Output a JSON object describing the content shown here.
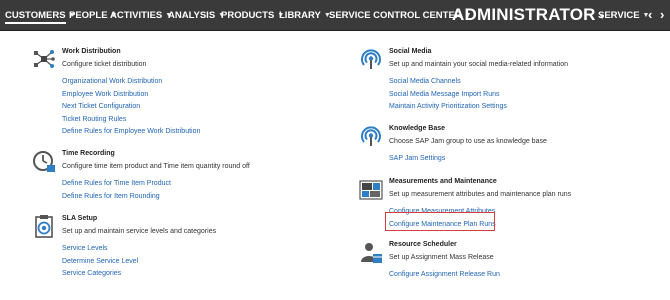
{
  "nav": {
    "customers": "CUSTOMERS",
    "people": "PEOPLE",
    "activities": "ACTIVITIES",
    "analysis": "ANALYSIS",
    "products": "PRODUCTS",
    "library": "LIBRARY",
    "service_control_center": "SERVICE CONTROL CENTER",
    "administrator": "ADMINISTRATOR",
    "service": "SERVICE"
  },
  "sections": {
    "work_distribution": {
      "title": "Work Distribution",
      "description": "Configure ticket distribution",
      "links": [
        "Organizational Work Distribution",
        "Employee Work Distribution",
        "Next Ticket Configuration",
        "Ticket Routing Rules",
        "Define Rules for Employee Work Distribution"
      ]
    },
    "time_recording": {
      "title": "Time Recording",
      "description": "Configure time item product and Time item quantity round off",
      "links": [
        "Define Rules for Time Item Product",
        "Define Rules for Item Rounding"
      ]
    },
    "sla_setup": {
      "title": "SLA Setup",
      "description": "Set up and maintain service levels and categories",
      "links": [
        "Service Levels",
        "Determine Service Level",
        "Service Categories"
      ]
    },
    "social_media": {
      "title": "Social Media",
      "description": "Set up and maintain your social media-related information",
      "links": [
        "Social Media Channels",
        "Social Media Message Import Runs",
        "Maintain Activity Prioritization Settings"
      ]
    },
    "knowledge_base": {
      "title": "Knowledge Base",
      "description": "Choose SAP Jam group to use as knowledge base",
      "links": [
        "SAP Jam Settings"
      ]
    },
    "measurements": {
      "title": "Measurements and Maintenance",
      "description": "Set up measurement attributes and maintenance plan runs",
      "links": [
        "Configure Measurement Attributes",
        "Configure Maintenance Plan Runs"
      ]
    },
    "resource_scheduler": {
      "title": "Resource Scheduler",
      "description": "Set up Assignment Mass Release",
      "links": [
        "Configure Assignment Release Run"
      ]
    }
  },
  "colors": {
    "nav_background": "#3a3a3a",
    "link": "#1f64b4",
    "icon_blue": "#2f7fc4",
    "highlight_border": "#d44040"
  },
  "icons": {
    "work_distribution": "network-nodes-icon",
    "time_recording": "clock-icon",
    "sla_setup": "clipboard-target-icon",
    "social_media": "broadcast-signal-icon",
    "knowledge_base": "broadcast-signal-icon",
    "measurements": "gauge-settings-icon",
    "resource_scheduler": "person-calendar-icon"
  }
}
